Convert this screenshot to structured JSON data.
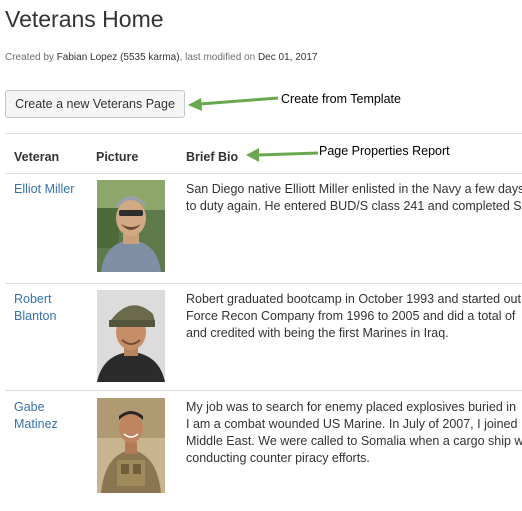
{
  "page": {
    "title": "Veterans Home",
    "meta_created_by": "Created by",
    "meta_author": "Fabian Lopez (5535 karma)",
    "meta_modified": ", last modified on",
    "meta_date": "Dec 01, 2017"
  },
  "toolbar": {
    "create_label": "Create a new Veterans Page"
  },
  "callouts": {
    "create_template": "Create from Template",
    "properties_report": "Page Properties Report"
  },
  "table": {
    "headers": [
      "Veteran",
      "Picture",
      "Brief Bio"
    ],
    "rows": [
      {
        "name_lines": [
          "Elliot Miller"
        ],
        "bio_lines": [
          "San Diego native Elliott Miller enlisted in the Navy a few days",
          "to duty again. He entered BUD/S class 241 and completed S"
        ]
      },
      {
        "name_lines": [
          "Robert",
          "Blanton"
        ],
        "bio_lines": [
          "Robert graduated bootcamp in October 1993 and started out",
          "Force Recon Company from 1996 to 2005 and did a total of",
          "and credited with being the first Marines in Iraq."
        ]
      },
      {
        "name_lines": [
          "Gabe",
          "Matinez"
        ],
        "bio_lines": [
          "My job was to search for enemy placed explosives buried in",
          "I am a combat wounded US Marine. In July of 2007, I joined",
          "Middle East. We were called to Somalia when a cargo ship w",
          "conducting counter piracy efforts."
        ]
      }
    ]
  },
  "colors": {
    "link": "#3572b0",
    "arrow": "#6aa84f"
  }
}
